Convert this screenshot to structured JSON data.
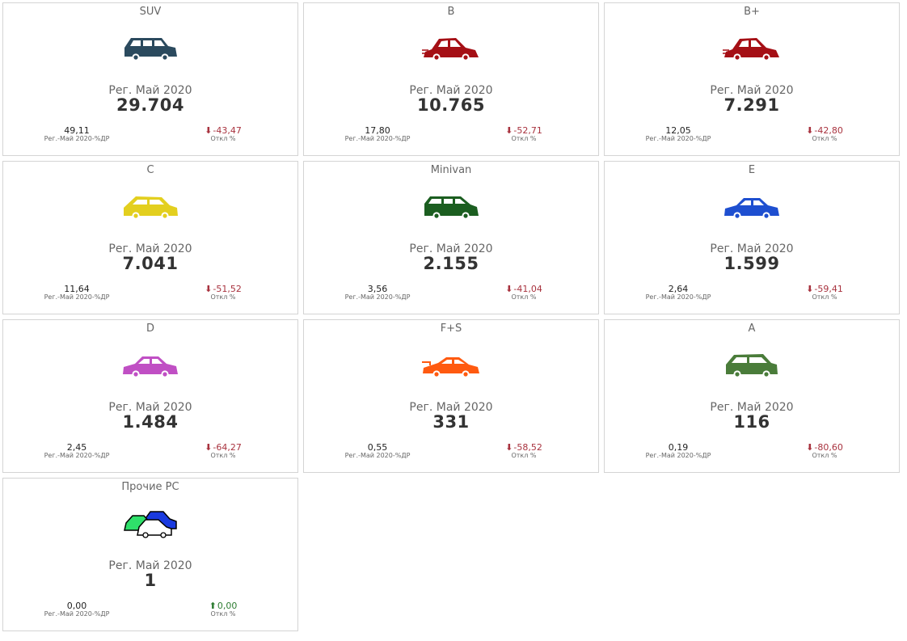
{
  "cards": [
    {
      "title": "SUV",
      "reg_label": "Рег. Май 2020",
      "value": "29.704",
      "share_value": "49,11",
      "share_label": "Рег.-Май 2020-%ДР",
      "dev_value": "-43,47",
      "dev_label": "Откл %",
      "dev_direction": "down",
      "car_color": "#2b4a5e",
      "car_icon": "suv-icon"
    },
    {
      "title": "B",
      "reg_label": "Рег. Май 2020",
      "value": "10.765",
      "share_value": "17,80",
      "share_label": "Рег.-Май 2020-%ДР",
      "dev_value": "-52,71",
      "dev_label": "Откл %",
      "dev_direction": "down",
      "car_color": "#a50f15",
      "car_icon": "beetle-car-icon"
    },
    {
      "title": "B+",
      "reg_label": "Рег. Май 2020",
      "value": "7.291",
      "share_value": "12,05",
      "share_label": "Рег.-Май 2020-%ДР",
      "dev_value": "-42,80",
      "dev_label": "Откл %",
      "dev_direction": "down",
      "car_color": "#a50f15",
      "car_icon": "beetle-car-icon"
    },
    {
      "title": "C",
      "reg_label": "Рег. Май 2020",
      "value": "7.041",
      "share_value": "11,64",
      "share_label": "Рег.-Май 2020-%ДР",
      "dev_value": "-51,52",
      "dev_label": "Откл %",
      "dev_direction": "down",
      "car_color": "#e3cf1f",
      "car_icon": "hatchback-icon"
    },
    {
      "title": "Minivan",
      "reg_label": "Рег. Май 2020",
      "value": "2.155",
      "share_value": "3,56",
      "share_label": "Рег.-Май 2020-%ДР",
      "dev_value": "-41,04",
      "dev_label": "Откл %",
      "dev_direction": "down",
      "car_color": "#1b5e20",
      "car_icon": "minivan-icon"
    },
    {
      "title": "E",
      "reg_label": "Рег. Май 2020",
      "value": "1.599",
      "share_value": "2,64",
      "share_label": "Рег.-Май 2020-%ДР",
      "dev_value": "-59,41",
      "dev_label": "Откл %",
      "dev_direction": "down",
      "car_color": "#1e4fd0",
      "car_icon": "sedan-icon"
    },
    {
      "title": "D",
      "reg_label": "Рег. Май 2020",
      "value": "1.484",
      "share_value": "2,45",
      "share_label": "Рег.-Май 2020-%ДР",
      "dev_value": "-64,27",
      "dev_label": "Откл %",
      "dev_direction": "down",
      "car_color": "#c04fc4",
      "car_icon": "sedan-icon"
    },
    {
      "title": "F+S",
      "reg_label": "Рег. Май 2020",
      "value": "331",
      "share_value": "0,55",
      "share_label": "Рег.-Май 2020-%ДР",
      "dev_value": "-58,52",
      "dev_label": "Откл %",
      "dev_direction": "down",
      "car_color": "#ff5a10",
      "car_icon": "sports-car-icon"
    },
    {
      "title": "A",
      "reg_label": "Рег. Май 2020",
      "value": "116",
      "share_value": "0,19",
      "share_label": "Рег.-Май 2020-%ДР",
      "dev_value": "-80,60",
      "dev_label": "Откл %",
      "dev_direction": "down",
      "car_color": "#4a7c3a",
      "car_icon": "city-car-icon"
    },
    {
      "title": "Прочие РС",
      "reg_label": "Рег. Май 2020",
      "value": "1",
      "share_value": "0,00",
      "share_label": "Рег.-Май 2020-%ДР",
      "dev_value": "0,00",
      "dev_label": "Откл %",
      "dev_direction": "up",
      "car_color": "#1a3adf",
      "car_icon": "multi-car-icon",
      "extra_colors": [
        "#2fe06a",
        "#1a3adf",
        "#ffffff"
      ]
    }
  ]
}
